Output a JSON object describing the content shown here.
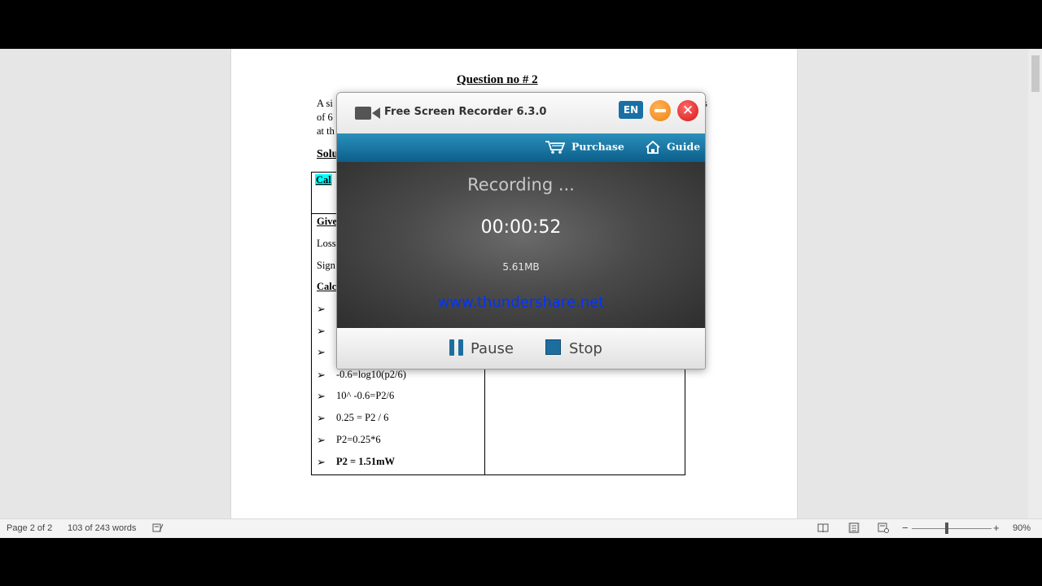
{
  "document": {
    "heading": "Question no # 2",
    "question_lines": [
      "A si",
      "of 6",
      "at th"
    ],
    "question_right": [
      "s",
      ""
    ],
    "solution_label": "Solu",
    "table_header": "Cal",
    "given_label": "Give",
    "given_lines": [
      "Loss",
      "Sign"
    ],
    "calc_label": "Calc",
    "steps": [
      "",
      "",
      "",
      "-0.6=log10(p2/6)",
      "10^ -0.6=P2/6",
      "0.25 = P2 / 6",
      "P2=0.25*6",
      "P2 = 1.51mW"
    ],
    "bullet_glyph": "➢"
  },
  "recorder": {
    "title": "Free Screen Recorder 6.3.0",
    "language_button": "EN",
    "close_glyph": "✕",
    "nav": {
      "purchase": "Purchase",
      "guide": "Guide"
    },
    "status": "Recording ...",
    "elapsed": "00:00:52",
    "file_size": "5.61MB",
    "website": "www.thundershare.net",
    "controls": {
      "pause": "Pause",
      "stop": "Stop"
    },
    "colors": {
      "accent": "#1a6fa5",
      "nav_top": "#2a8fbb",
      "nav_bottom": "#0d5f8b",
      "minimize": "#f0820f",
      "close": "#d41616",
      "url": "#0033ff"
    }
  },
  "statusbar": {
    "page": "Page 2 of 2",
    "words": "103 of 243 words",
    "zoom_minus": "−",
    "zoom_plus": "+",
    "zoom": "90%",
    "zoom_level_percent": 90
  }
}
